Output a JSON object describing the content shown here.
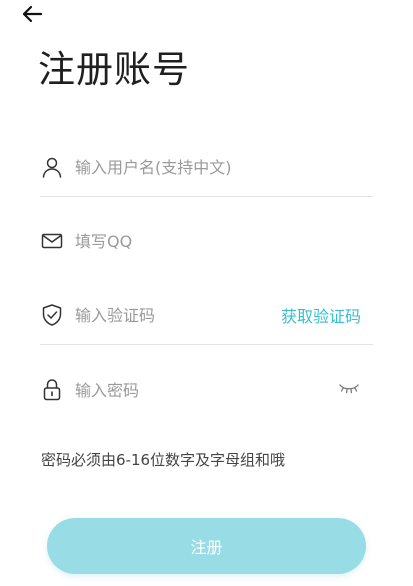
{
  "header": {
    "back_icon": "arrow-left-icon",
    "title": "注册账号"
  },
  "form": {
    "username": {
      "icon": "user-icon",
      "placeholder": "输入用户名(支持中文)",
      "value": ""
    },
    "qq": {
      "icon": "mail-icon",
      "placeholder": "填写QQ",
      "value": ""
    },
    "verification_code": {
      "icon": "shield-check-icon",
      "placeholder": "输入验证码",
      "value": "",
      "action_label": "获取验证码"
    },
    "password": {
      "icon": "lock-icon",
      "placeholder": "输入密码",
      "value": "",
      "toggle_icon": "eye-closed-icon"
    },
    "password_hint": "密码必须由6-16位数字及字母组和哦",
    "submit_label": "注册"
  },
  "colors": {
    "accent": "#36bfd0",
    "button_bg": "#98dde6",
    "divider": "#e3e3e3",
    "placeholder": "#9a9a9a"
  }
}
